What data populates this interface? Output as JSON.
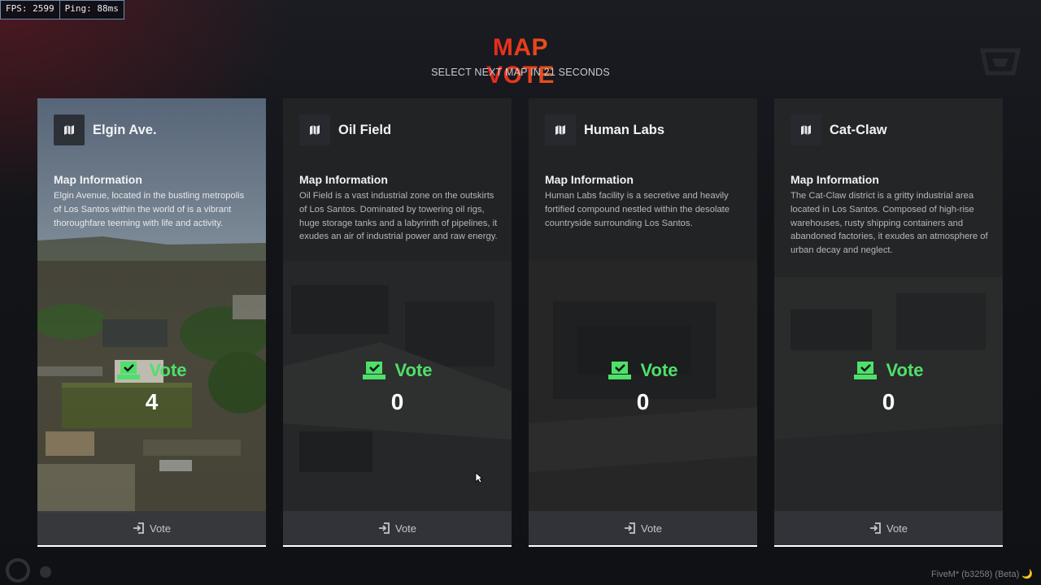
{
  "overlay": {
    "fps": "FPS: 2599",
    "ping": "Ping: 88ms"
  },
  "header": {
    "title": "MAP VOTE",
    "subtitle": "SELECT NEXT MAP IN 21 SECONDS"
  },
  "cards": [
    {
      "name": "Elgin Ave.",
      "info_title": "Map Information",
      "info_text": "Elgin Avenue, located in the bustling metropolis of Los Santos within the world of is a vibrant thoroughfare teeming with life and activity.",
      "vote_label": "Vote",
      "votes": "4",
      "button_label": "Vote"
    },
    {
      "name": "Oil Field",
      "info_title": "Map Information",
      "info_text": "Oil Field is a vast industrial zone on the outskirts of Los Santos. Dominated by towering oil rigs, huge storage tanks and a labyrinth of pipelines, it exudes an air of industrial power and raw energy.",
      "vote_label": "Vote",
      "votes": "0",
      "button_label": "Vote"
    },
    {
      "name": "Human Labs",
      "info_title": "Map Information",
      "info_text": "Human Labs facility is a secretive and heavily fortified compound nestled within the desolate countryside surrounding Los Santos.",
      "vote_label": "Vote",
      "votes": "0",
      "button_label": "Vote"
    },
    {
      "name": "Cat-Claw",
      "info_title": "Map Information",
      "info_text": "The Cat-Claw district is a gritty industrial area located in Los Santos. Composed of high-rise warehouses, rusty shipping containers and abandoned factories, it exudes an atmosphere of urban decay and neglect.",
      "vote_label": "Vote",
      "votes": "0",
      "button_label": "Vote"
    }
  ],
  "footer": {
    "client_label": "FiveM* (b3258) (Beta) 🌙"
  },
  "colors": {
    "accent_red": "#e0141e",
    "accent_orange": "#e86a1c",
    "vote_green": "#4fe06a"
  },
  "icons": [
    "map-icon",
    "vote-ballot-icon",
    "enter-icon",
    "mouse-cursor-icon"
  ]
}
